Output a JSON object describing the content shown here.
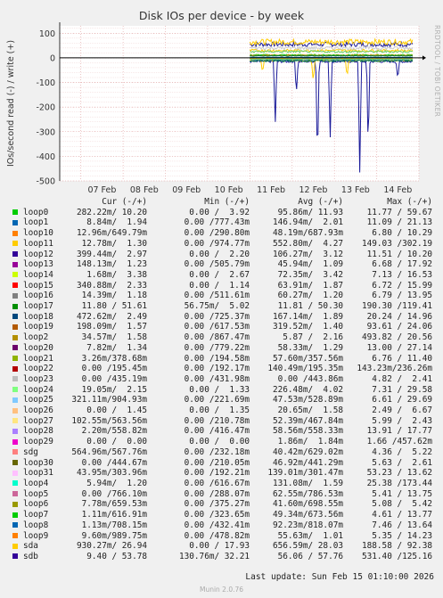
{
  "chart_data": {
    "type": "line",
    "title": "Disk IOs per device - by week",
    "ylabel": "IOs/second read (-) / write (+)",
    "ylim": [
      -500,
      130
    ],
    "yticks": [
      100,
      0,
      -100,
      -200,
      -300,
      -400,
      -500
    ],
    "xlabels": [
      "07 Feb",
      "08 Feb",
      "09 Feb",
      "10 Feb",
      "11 Feb",
      "12 Feb",
      "13 Feb",
      "14 Feb"
    ],
    "grid": true,
    "series": [
      {
        "name": "sdb",
        "color": "#1a1a99",
        "write_level": 55,
        "read_level": -15,
        "read_spikes": [
          [
            11.6,
            -270
          ],
          [
            12.1,
            -150
          ],
          [
            12.6,
            -440
          ],
          [
            12.9,
            -330
          ],
          [
            13.6,
            -480
          ],
          [
            13.8,
            -380
          ],
          [
            14.5,
            -90
          ]
        ]
      },
      {
        "name": "sda",
        "color": "#ffcc00",
        "write_level": 65,
        "read_level": -10,
        "read_spikes": [
          [
            11.3,
            -60
          ],
          [
            12.5,
            -100
          ],
          [
            13.3,
            -80
          ]
        ]
      },
      {
        "name": "loop0",
        "color": "#00cc00",
        "write_level": 12,
        "read_level": -2
      },
      {
        "name": "loop1",
        "color": "#0066b3",
        "write_level": 2,
        "read_level": -8
      },
      {
        "name": "loop10",
        "color": "#ff8000",
        "write_level": 10,
        "read_level": -1
      },
      {
        "name": "loop11",
        "color": "#ffcc00",
        "write_level": 30,
        "read_level": -4
      },
      {
        "name": "loop17",
        "color": "#007a3d",
        "write_level": 8,
        "read_level": -12
      },
      {
        "name": "loop23",
        "color": "#cccccc",
        "write_level": 40,
        "read_level": -6
      },
      {
        "name": "loop6",
        "color": "#66cc66",
        "write_level": 25,
        "read_level": -5
      }
    ]
  },
  "legend": {
    "headers": {
      "cur": "Cur (-/+)",
      "min": "Min (-/+)",
      "avg": "Avg (-/+)",
      "max": "Max (-/+)"
    },
    "rows": [
      {
        "name": "loop0",
        "color": "#00cc00",
        "cur": "282.22m/ 10.20",
        "min": "0.00 /  3.92",
        "avg": "95.86m/ 11.93",
        "max": "11.77 / 59.67"
      },
      {
        "name": "loop1",
        "color": "#0066b3",
        "cur": "8.84m/  1.94",
        "min": "0.00 /777.43m",
        "avg": "146.94m/  2.01",
        "max": "11.09 / 21.13"
      },
      {
        "name": "loop10",
        "color": "#ff8000",
        "cur": "12.96m/649.79m",
        "min": "0.00 /290.80m",
        "avg": "48.19m/687.93m",
        "max": "6.80 / 10.29"
      },
      {
        "name": "loop11",
        "color": "#ffcc00",
        "cur": "12.78m/  1.30",
        "min": "0.00 /974.77m",
        "avg": "552.80m/  4.27",
        "max": "149.03 /302.19"
      },
      {
        "name": "loop12",
        "color": "#330099",
        "cur": "399.44m/  2.97",
        "min": "0.00 /  2.20",
        "avg": "106.27m/  3.12",
        "max": "11.51 / 10.20"
      },
      {
        "name": "loop13",
        "color": "#990099",
        "cur": "148.13m/  1.23",
        "min": "0.00 /505.79m",
        "avg": "45.94m/  1.09",
        "max": "6.68 / 17.92"
      },
      {
        "name": "loop14",
        "color": "#ccff00",
        "cur": "1.68m/  3.38",
        "min": "0.00 /  2.67",
        "avg": "72.35m/  3.42",
        "max": "7.13 / 16.53"
      },
      {
        "name": "loop15",
        "color": "#ff0000",
        "cur": "340.88m/  2.33",
        "min": "0.00 /  1.14",
        "avg": "63.91m/  1.87",
        "max": "6.72 / 15.99"
      },
      {
        "name": "loop16",
        "color": "#808080",
        "cur": "14.39m/  1.18",
        "min": "0.00 /511.61m",
        "avg": "60.27m/  1.20",
        "max": "6.79 / 13.95"
      },
      {
        "name": "loop17",
        "color": "#008f00",
        "cur": "11.80 / 51.61",
        "min": "56.75m/  5.02",
        "avg": "11.81 / 50.30",
        "max": "190.30 /119.41"
      },
      {
        "name": "loop18",
        "color": "#00487d",
        "cur": "472.62m/  2.49",
        "min": "0.00 /725.37m",
        "avg": "167.14m/  1.89",
        "max": "20.24 / 14.96"
      },
      {
        "name": "loop19",
        "color": "#b35a00",
        "cur": "198.09m/  1.57",
        "min": "0.00 /617.53m",
        "avg": "319.52m/  1.40",
        "max": "93.61 / 24.06"
      },
      {
        "name": "loop2",
        "color": "#b38f00",
        "cur": "34.57m/  1.58",
        "min": "0.00 /867.47m",
        "avg": "5.87 /  2.16",
        "max": "493.82 / 20.56"
      },
      {
        "name": "loop20",
        "color": "#6b006b",
        "cur": "7.82m/  1.34",
        "min": "0.00 /779.22m",
        "avg": "58.33m/  1.29",
        "max": "13.00 / 27.14"
      },
      {
        "name": "loop21",
        "color": "#8fb300",
        "cur": "3.26m/378.68m",
        "min": "0.00 /194.58m",
        "avg": "57.60m/357.56m",
        "max": "6.76 / 11.40"
      },
      {
        "name": "loop22",
        "color": "#b30000",
        "cur": "0.00 /195.45m",
        "min": "0.00 /192.17m",
        "avg": "140.49m/195.35m",
        "max": "143.23m/236.26m"
      },
      {
        "name": "loop23",
        "color": "#bebebe",
        "cur": "0.00 /435.19m",
        "min": "0.00 /431.98m",
        "avg": "0.00 /443.86m",
        "max": "4.82 /  2.41"
      },
      {
        "name": "loop24",
        "color": "#80ff80",
        "cur": "19.05m/  2.15",
        "min": "0.00 /  1.33",
        "avg": "226.48m/  4.02",
        "max": "7.31 / 29.58"
      },
      {
        "name": "loop25",
        "color": "#80c9ff",
        "cur": "321.11m/904.93m",
        "min": "0.00 /221.69m",
        "avg": "47.53m/528.89m",
        "max": "6.61 / 29.69"
      },
      {
        "name": "loop26",
        "color": "#ffc080",
        "cur": "0.00 /  1.45",
        "min": "0.00 /  1.35",
        "avg": "20.65m/  1.58",
        "max": "2.49 /  6.67"
      },
      {
        "name": "loop27",
        "color": "#ffe680",
        "cur": "102.55m/563.56m",
        "min": "0.00 /210.78m",
        "avg": "52.39m/467.84m",
        "max": "5.99 /  2.43"
      },
      {
        "name": "loop28",
        "color": "#aa80ff",
        "cur": "2.20m/558.82m",
        "min": "0.00 /416.47m",
        "avg": "58.56m/558.33m",
        "max": "13.91 / 17.77"
      },
      {
        "name": "loop29",
        "color": "#ee00cc",
        "cur": "0.00 /  0.00",
        "min": "0.00 /  0.00",
        "avg": "1.86m/  1.84m",
        "max": "1.66 /457.62m"
      },
      {
        "name": "sdg",
        "color": "#ff8080",
        "cur": "564.96m/567.76m",
        "min": "0.00 /232.18m",
        "avg": "40.42m/629.02m",
        "max": "4.36 /  5.22"
      },
      {
        "name": "loop30",
        "color": "#666600",
        "cur": "0.00 /444.67m",
        "min": "0.00 /210.05m",
        "avg": "46.92m/441.29m",
        "max": "5.63 /  2.61"
      },
      {
        "name": "loop31",
        "color": "#ffbfff",
        "cur": "43.95m/303.96m",
        "min": "0.00 /192.21m",
        "avg": "139.01m/301.47m",
        "max": "53.23 / 13.62"
      },
      {
        "name": "loop4",
        "color": "#00ffcc",
        "cur": "5.94m/  1.20",
        "min": "0.00 /616.67m",
        "avg": "131.08m/  1.59",
        "max": "25.38 /173.44"
      },
      {
        "name": "loop5",
        "color": "#cc6699",
        "cur": "0.00 /766.10m",
        "min": "0.00 /288.07m",
        "avg": "62.55m/786.53m",
        "max": "5.41 / 13.75"
      },
      {
        "name": "loop6",
        "color": "#999900",
        "cur": "7.78m/659.53m",
        "min": "0.00 /375.27m",
        "avg": "41.60m/698.55m",
        "max": "5.08 /  5.42"
      },
      {
        "name": "loop7",
        "color": "#00cc00",
        "cur": "1.11m/616.91m",
        "min": "0.00 /323.65m",
        "avg": "49.34m/673.56m",
        "max": "4.61 / 13.77"
      },
      {
        "name": "loop8",
        "color": "#0066b3",
        "cur": "1.13m/708.15m",
        "min": "0.00 /432.41m",
        "avg": "92.23m/818.07m",
        "max": "7.46 / 13.64"
      },
      {
        "name": "loop9",
        "color": "#ff8000",
        "cur": "9.60m/989.75m",
        "min": "0.00 /478.82m",
        "avg": "55.63m/  1.01",
        "max": "5.35 / 14.23"
      },
      {
        "name": "sda",
        "color": "#ffcc00",
        "cur": "930.27m/ 26.94",
        "min": "0.00 / 17.93",
        "avg": "656.59m/ 28.03",
        "max": "188.58 / 92.38"
      },
      {
        "name": "sdb",
        "color": "#330099",
        "cur": "9.40 / 53.78",
        "min": "130.76m/ 32.21",
        "avg": "56.06 / 57.76",
        "max": "531.40 /125.16"
      }
    ]
  },
  "footer": {
    "last_update": "Last update: Sun Feb 15 01:10:00 2026",
    "munin_version": "Munin 2.0.76"
  },
  "watermark": "RRDTOOL / TOBI OETIKER"
}
